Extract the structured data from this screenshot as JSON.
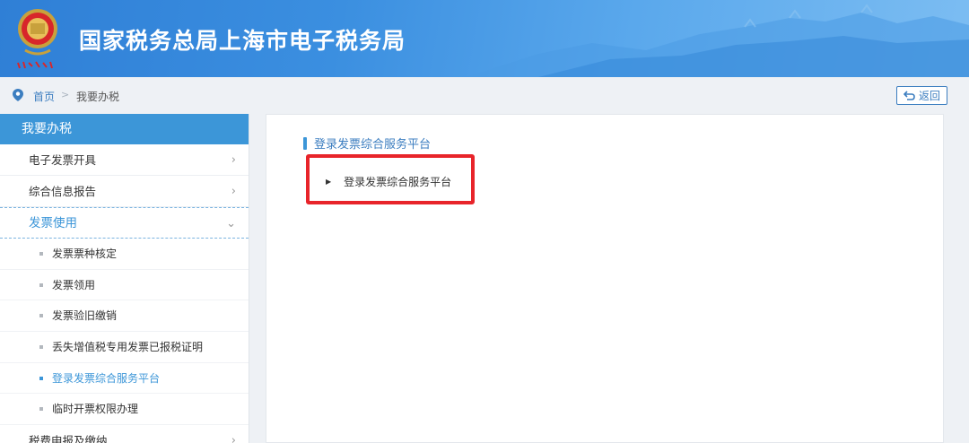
{
  "header": {
    "title": "国家税务总局上海市电子税务局",
    "brand_color": "#3b8fe0"
  },
  "breadcrumb": {
    "home": "首页",
    "separator": ">",
    "current": "我要办税",
    "back_label": "返回"
  },
  "sidebar": {
    "title": "我要办税",
    "items": [
      {
        "label": "电子发票开具",
        "chevron": "›"
      },
      {
        "label": "综合信息报告",
        "chevron": "›"
      },
      {
        "label": "发票使用",
        "chevron": "⌄"
      }
    ],
    "sub_items": [
      {
        "label": "发票票种核定"
      },
      {
        "label": "发票领用"
      },
      {
        "label": "发票验旧缴销"
      },
      {
        "label": "丢失增值税专用发票已报税证明"
      },
      {
        "label": "登录发票综合服务平台",
        "active": true
      },
      {
        "label": "临时开票权限办理"
      }
    ],
    "after_items": [
      {
        "label": "税费申报及缴纳",
        "chevron": "›"
      }
    ]
  },
  "main": {
    "section_title": "登录发票综合服务平台",
    "links": [
      {
        "label": "登录发票综合服务平台",
        "icon": "play-arrow-icon"
      }
    ],
    "highlight_color": "#e8242a"
  }
}
